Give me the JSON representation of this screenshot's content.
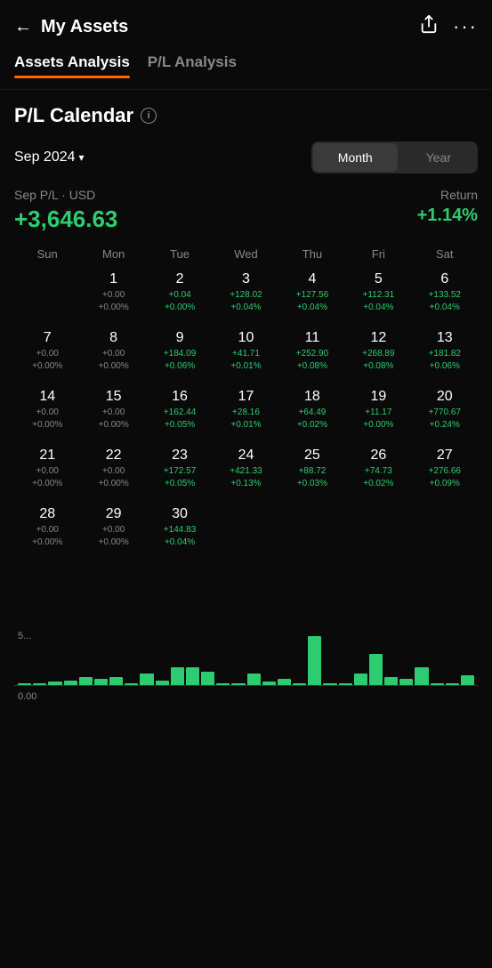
{
  "header": {
    "title": "My Assets",
    "back_icon": "←",
    "share_icon": "↗",
    "more_icon": "⋯"
  },
  "tabs": [
    {
      "id": "assets",
      "label": "Assets Analysis",
      "active": true
    },
    {
      "id": "pl",
      "label": "P/L Analysis",
      "active": false
    }
  ],
  "section": {
    "title": "P/L Calendar",
    "info_icon": "i"
  },
  "period": {
    "label": "Sep 2024",
    "arrow": "▾"
  },
  "view_toggle": {
    "month_label": "Month",
    "year_label": "Year",
    "active": "month"
  },
  "summary": {
    "pl_label": "Sep P/L · USD",
    "pl_value": "+3,646.63",
    "return_label": "Return",
    "return_value": "+1.14%"
  },
  "calendar": {
    "days_of_week": [
      "Sun",
      "Mon",
      "Tue",
      "Wed",
      "Thu",
      "Fri",
      "Sat"
    ],
    "weeks": [
      [
        {
          "day": null
        },
        {
          "day": "1",
          "pl": "+0.00",
          "pct": "+0.00%"
        },
        {
          "day": "2",
          "pl": "+0.04",
          "pct": "+0.00%"
        },
        {
          "day": "3",
          "pl": "+128.02",
          "pct": "+0.04%"
        },
        {
          "day": "4",
          "pl": "+127.56",
          "pct": "+0.04%"
        },
        {
          "day": "5",
          "pl": "+112.31",
          "pct": "+0.04%"
        },
        {
          "day": "6",
          "pl": "+133.52",
          "pct": "+0.04%"
        },
        {
          "day": "7",
          "pl": "+0.00",
          "pct": "+0.00%"
        }
      ],
      [
        {
          "day": "8",
          "pl": "+0.00",
          "pct": "+0.00%"
        },
        {
          "day": "9",
          "pl": "+184.09",
          "pct": "+0.06%"
        },
        {
          "day": "10",
          "pl": "+41.71",
          "pct": "+0.01%"
        },
        {
          "day": "11",
          "pl": "+252.90",
          "pct": "+0.08%"
        },
        {
          "day": "12",
          "pl": "+268.89",
          "pct": "+0.08%"
        },
        {
          "day": "13",
          "pl": "+181.82",
          "pct": "+0.06%"
        },
        {
          "day": "14",
          "pl": "+0.00",
          "pct": "+0.00%"
        }
      ],
      [
        {
          "day": "15",
          "pl": "+0.00",
          "pct": "+0.00%"
        },
        {
          "day": "16",
          "pl": "+162.44",
          "pct": "+0.05%"
        },
        {
          "day": "17",
          "pl": "+28.16",
          "pct": "+0.01%"
        },
        {
          "day": "18",
          "pl": "+64.49",
          "pct": "+0.02%"
        },
        {
          "day": "19",
          "pl": "+11.17",
          "pct": "+0.00%"
        },
        {
          "day": "20",
          "pl": "+770.67",
          "pct": "+0.24%"
        },
        {
          "day": "21",
          "pl": "+0.00",
          "pct": "+0.00%"
        }
      ],
      [
        {
          "day": "22",
          "pl": "+0.00",
          "pct": "+0.00%"
        },
        {
          "day": "23",
          "pl": "+172.57",
          "pct": "+0.05%"
        },
        {
          "day": "24",
          "pl": "+421.33",
          "pct": "+0.13%"
        },
        {
          "day": "25",
          "pl": "+88.72",
          "pct": "+0.03%"
        },
        {
          "day": "26",
          "pl": "+74.73",
          "pct": "+0.02%"
        },
        {
          "day": "27",
          "pl": "+276.66",
          "pct": "+0.09%"
        },
        {
          "day": "28",
          "pl": "+0.00",
          "pct": "+0.00%"
        }
      ],
      [
        {
          "day": "29",
          "pl": "+0.00",
          "pct": "+0.00%"
        },
        {
          "day": "30",
          "pl": "+144.83",
          "pct": "+0.04%"
        },
        {
          "day": null
        },
        {
          "day": null
        },
        {
          "day": null
        },
        {
          "day": null
        },
        {
          "day": null
        }
      ]
    ]
  },
  "chart": {
    "top_label": "5...",
    "bottom_label": "0.00",
    "bars": [
      2,
      2,
      4,
      5,
      8,
      6,
      8,
      2,
      12,
      5,
      18,
      18,
      14,
      2,
      2,
      12,
      4,
      6,
      2,
      50,
      2,
      2,
      12,
      32,
      8,
      6,
      18,
      2,
      2,
      10
    ]
  }
}
